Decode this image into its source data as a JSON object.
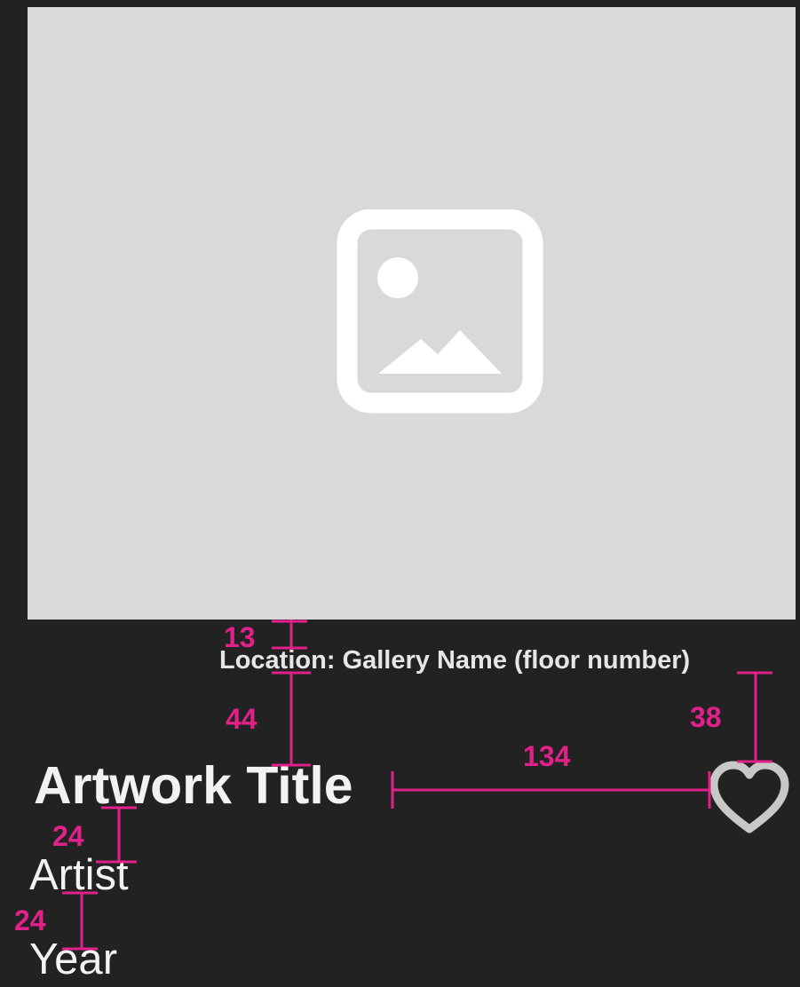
{
  "artwork": {
    "location_label": "Location:",
    "location_value": "Gallery Name (floor number)",
    "title": "Artwork Title",
    "artist": "Artist",
    "year": "Year",
    "image_icon": "image-placeholder-icon",
    "favorite_icon": "heart-icon"
  },
  "annotations": {
    "image_to_location": "13",
    "location_to_title": "44",
    "location_to_heart": "38",
    "title_to_heart": "134",
    "title_to_artist": "24",
    "artist_to_year": "24"
  },
  "colors": {
    "background": "#222222",
    "placeholder": "#d9d9d9",
    "text": "#f2f2f2",
    "annotation": "#e0218a",
    "heart": "#c8c8c8"
  }
}
